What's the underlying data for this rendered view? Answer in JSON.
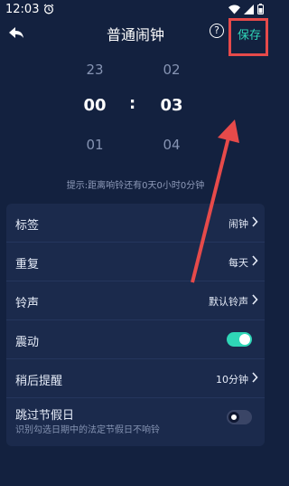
{
  "status_bar": {
    "time": "12:03"
  },
  "nav": {
    "title": "普通闹钟",
    "save_label": "保存",
    "help_glyph": "?"
  },
  "picker": {
    "hours": {
      "prev": "23",
      "selected": "00",
      "next": "01"
    },
    "minutes": {
      "prev": "02",
      "selected": "03",
      "next": "04"
    },
    "separator": ":"
  },
  "hint": "提示:距离响铃还有0天0小时0分钟",
  "settings": {
    "label": {
      "title": "标签",
      "value": "闹钟"
    },
    "repeat": {
      "title": "重复",
      "value": "每天"
    },
    "ringtone": {
      "title": "铃声",
      "value": "默认铃声"
    },
    "vibrate": {
      "title": "震动",
      "on": true
    },
    "snooze": {
      "title": "稍后提醒",
      "value": "10分钟"
    },
    "skip_holiday": {
      "title": "跳过节假日",
      "subtitle": "识别勾选日期中的法定节假日不响铃",
      "on": false
    }
  },
  "colors": {
    "background": "#13213f",
    "card": "#1b2a4c",
    "accent": "#2fd6b7",
    "annotation": "#e64a4a"
  }
}
